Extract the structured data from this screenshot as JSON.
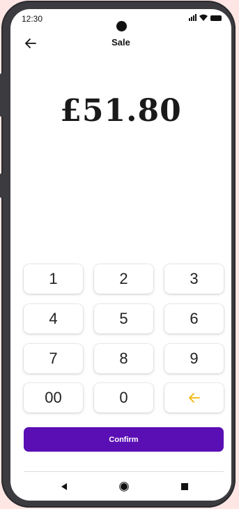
{
  "status_bar": {
    "time": "12:30"
  },
  "header": {
    "title": "Sale"
  },
  "amount": "£51.80",
  "keypad": {
    "rows": [
      [
        "1",
        "2",
        "3"
      ],
      [
        "4",
        "5",
        "6"
      ],
      [
        "7",
        "8",
        "9"
      ],
      [
        "00",
        "0",
        ""
      ]
    ],
    "accent_color": "#f2b705"
  },
  "confirm_label": "Confirm",
  "colors": {
    "brand": "#5a0fb4",
    "background": "#ffffff"
  },
  "icons": {
    "back": "arrow-left-icon",
    "backspace": "arrow-left-icon",
    "nav_back": "triangle-back-icon",
    "nav_home": "circle-home-icon",
    "nav_recents": "square-recents-icon"
  }
}
